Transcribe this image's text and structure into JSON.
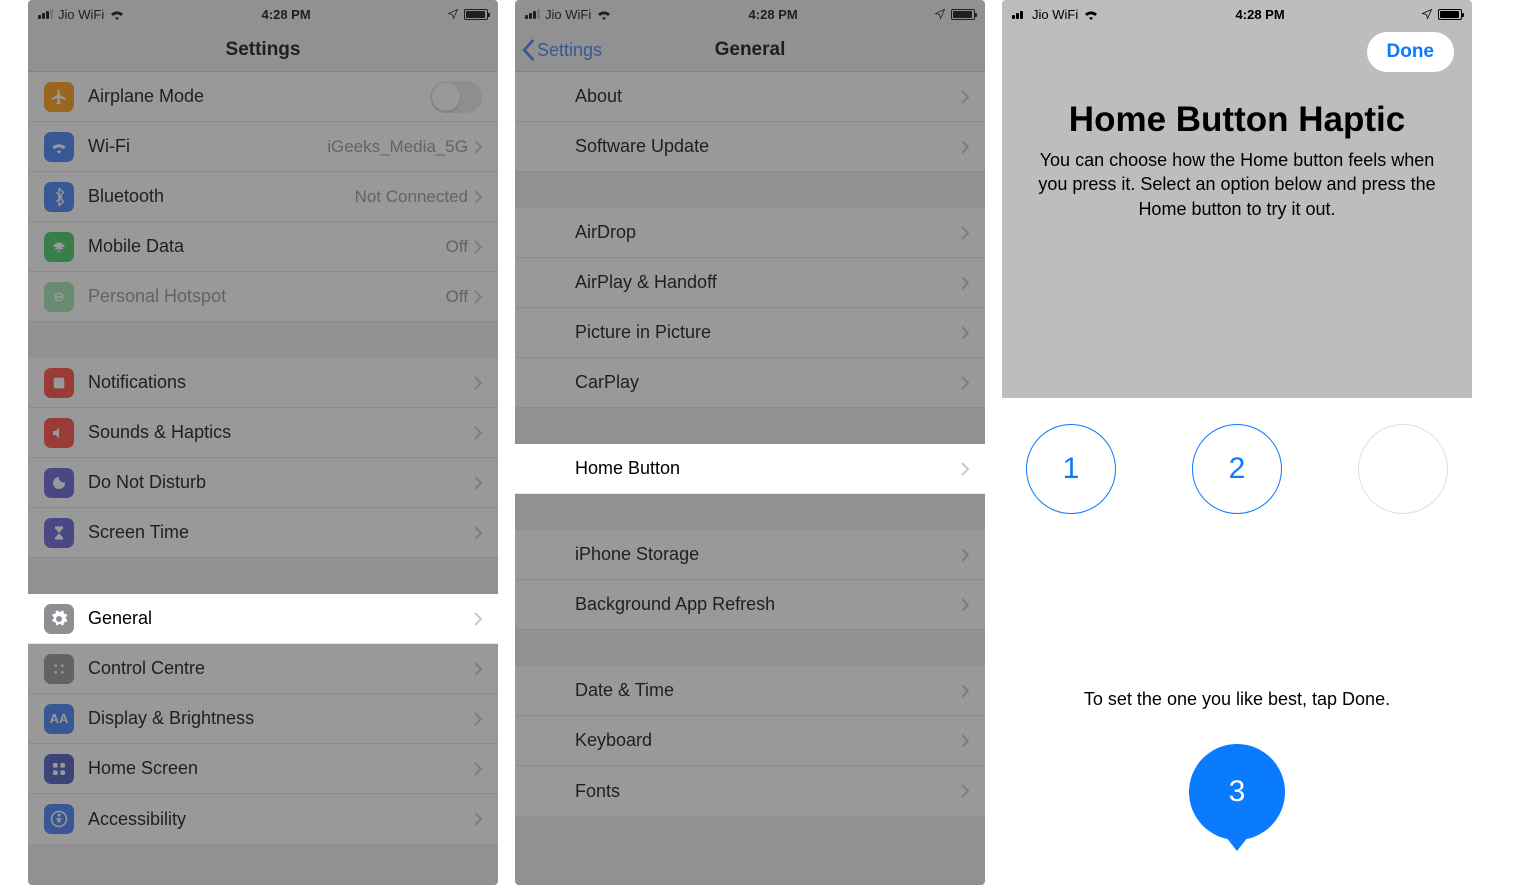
{
  "status": {
    "carrier": "Jio WiFi",
    "time": "4:28 PM"
  },
  "screen1": {
    "title": "Settings",
    "rows": {
      "airplane": "Airplane Mode",
      "wifi": "Wi-Fi",
      "wifi_val": "iGeeks_Media_5G",
      "bluetooth": "Bluetooth",
      "bluetooth_val": "Not Connected",
      "mobile": "Mobile Data",
      "mobile_val": "Off",
      "hotspot": "Personal Hotspot",
      "hotspot_val": "Off",
      "notifications": "Notifications",
      "sounds": "Sounds & Haptics",
      "dnd": "Do Not Disturb",
      "screentime": "Screen Time",
      "general": "General",
      "control": "Control Centre",
      "display": "Display & Brightness",
      "homescreen": "Home Screen",
      "accessibility": "Accessibility"
    }
  },
  "screen2": {
    "back": "Settings",
    "title": "General",
    "rows": {
      "about": "About",
      "software": "Software Update",
      "airdrop": "AirDrop",
      "airplay": "AirPlay & Handoff",
      "pip": "Picture in Picture",
      "carplay": "CarPlay",
      "home": "Home Button",
      "storage": "iPhone Storage",
      "refresh": "Background App Refresh",
      "datetime": "Date & Time",
      "keyboard": "Keyboard",
      "fonts": "Fonts"
    }
  },
  "screen3": {
    "done": "Done",
    "title": "Home Button Haptic",
    "desc": "You can choose how the Home button feels when you press it. Select an option below and press the Home button to try it out.",
    "opt1": "1",
    "opt2": "2",
    "opt3": "3",
    "hint": "To set the one you like best, tap Done."
  },
  "icons": {
    "airplane_bg": "#ff9500",
    "wifi_bg": "#3478f6",
    "bluetooth_bg": "#3478f6",
    "mobile_bg": "#34c759",
    "hotspot_bg": "#34c759",
    "notifications_bg": "#ff3b30",
    "sounds_bg": "#ff3b30",
    "dnd_bg": "#5856d6",
    "screentime_bg": "#5856d6",
    "general_bg": "#8e8e93",
    "control_bg": "#8e8e93",
    "display_bg": "#3478f6",
    "homescreen_bg": "#3e4db8",
    "accessibility_bg": "#3478f6"
  }
}
